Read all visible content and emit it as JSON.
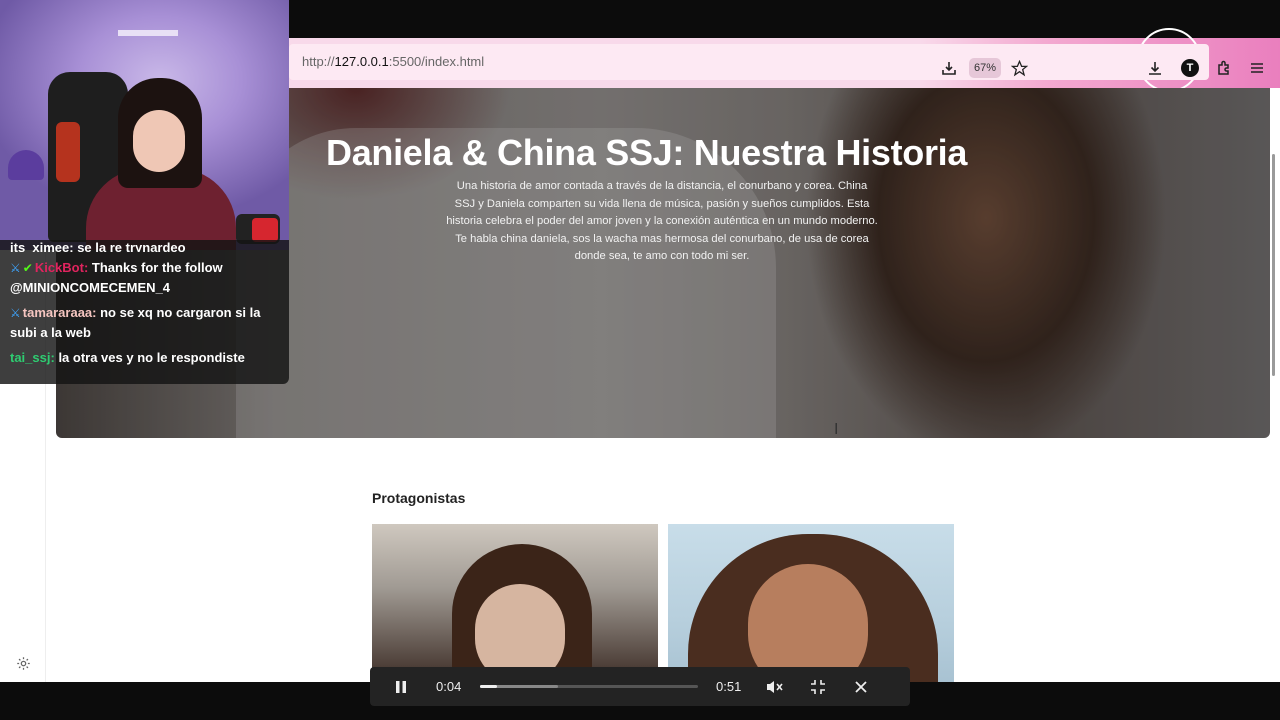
{
  "browser": {
    "url_prefix": "http://",
    "url_host": "127.0.0.1",
    "url_rest": ":5500/index.html",
    "zoom": "67%",
    "account_initial": "T"
  },
  "hero": {
    "title": "Daniela & China SSJ: Nuestra Historia",
    "description": "Una historia de amor contada a través de la distancia, el conurbano y corea. China SSJ y Daniela comparten su vida llena de música, pasión y sueños cumplidos. Esta historia celebra el poder del amor joven y la conexión auténtica en un mundo moderno. Te habla china daniela, sos la wacha mas hermosa del conurbano, de usa de corea donde sea, te amo con todo mi ser."
  },
  "section": {
    "title": "Protagonistas"
  },
  "chat": {
    "partial_line": "its_ximee: se la re trynardeo",
    "messages": [
      {
        "user": "KickBot:",
        "text": "Thanks for the follow @MINIONCOMECEMEN_4",
        "user_color": "#e0245e"
      },
      {
        "user": "tamararaaa:",
        "text": "no se xq no cargaron si la subi a la web",
        "user_color": "#f5c5c0"
      },
      {
        "user": "tai_ssj:",
        "text": "la otra ves y no le respondiste",
        "user_color": "#2ecc71"
      }
    ]
  },
  "player": {
    "current_time": "0:04",
    "duration": "0:51",
    "progress": 0.078,
    "buffered": 0.36
  },
  "icons": {
    "save_page": "save-page-icon",
    "bookmark": "star-icon",
    "download": "download-icon",
    "extensions": "extensions-icon",
    "menu": "hamburger-menu-icon",
    "settings": "gear-icon",
    "pause": "pause-icon",
    "mute": "mute-icon",
    "fullscreen_exit": "exit-fullscreen-icon",
    "close": "close-icon"
  }
}
